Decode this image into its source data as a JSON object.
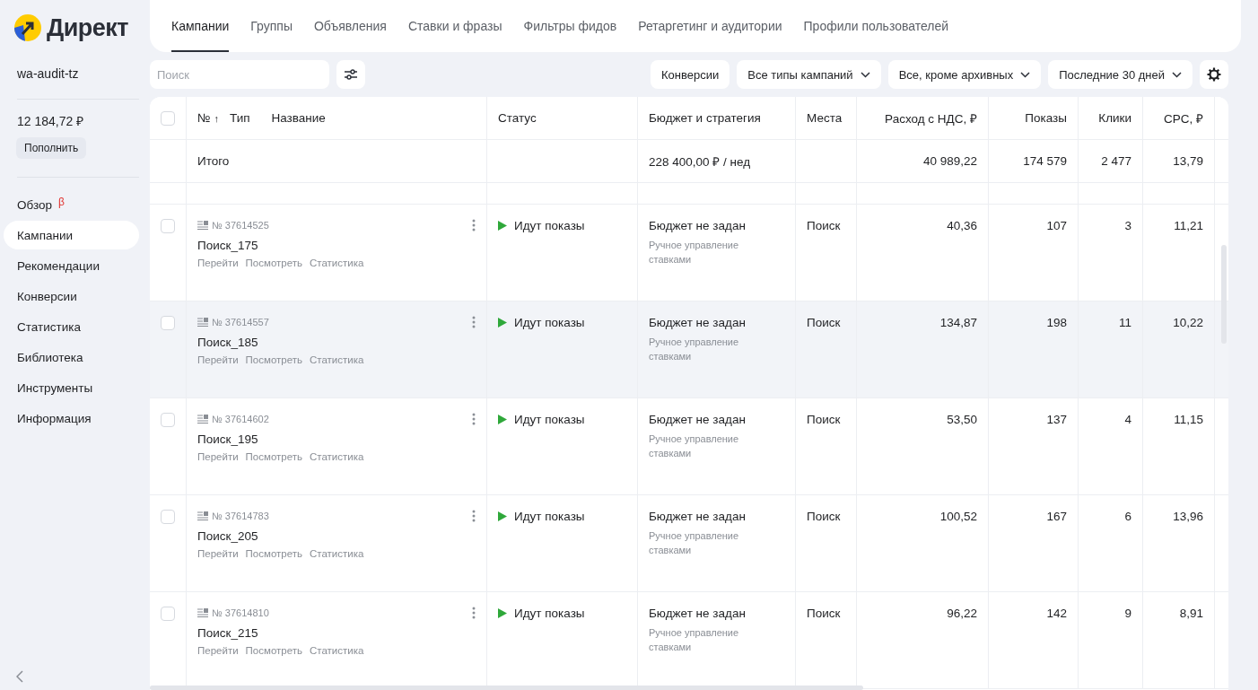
{
  "logo": {
    "text": "Директ"
  },
  "account": {
    "login": "wa-audit-tz",
    "balance": "12 184,72 ₽",
    "topup": "Пополнить"
  },
  "sidebar": {
    "items": [
      {
        "label": "Обзор",
        "badge": "β",
        "selected": false
      },
      {
        "label": "Кампании",
        "selected": true
      },
      {
        "label": "Рекомендации",
        "selected": false
      },
      {
        "label": "Конверсии",
        "selected": false
      },
      {
        "label": "Статистика",
        "selected": false
      },
      {
        "label": "Библиотека",
        "selected": false
      },
      {
        "label": "Инструменты",
        "selected": false
      },
      {
        "label": "Информация",
        "selected": false
      }
    ]
  },
  "tabs": [
    {
      "label": "Кампании",
      "selected": true
    },
    {
      "label": "Группы",
      "selected": false
    },
    {
      "label": "Объявления",
      "selected": false
    },
    {
      "label": "Ставки и фразы",
      "selected": false
    },
    {
      "label": "Фильтры фидов",
      "selected": false
    },
    {
      "label": "Ретаргетинг и аудитории",
      "selected": false
    },
    {
      "label": "Профили пользователей",
      "selected": false
    }
  ],
  "toolbar": {
    "search_placeholder": "Поиск",
    "filters": [
      {
        "label": "Конверсии",
        "dropdown": false
      },
      {
        "label": "Все типы кампаний",
        "dropdown": true
      },
      {
        "label": "Все, кроме архивных",
        "dropdown": true
      },
      {
        "label": "Последние 30 дней",
        "dropdown": true
      }
    ]
  },
  "table": {
    "select_all_checked": false,
    "columns": {
      "number": "№",
      "sort": "↑",
      "type": "Тип",
      "name": "Название",
      "status": "Статус",
      "budget": "Бюджет и стратегия",
      "places": "Места",
      "spend": "Расход с НДС, ₽",
      "shows": "Показы",
      "clicks": "Клики",
      "cpc": "CPC, ₽"
    },
    "total": {
      "label": "Итого",
      "budget": "228 400,00 ₽ / нед",
      "spend": "40 989,22",
      "shows": "174 579",
      "clicks": "2 477",
      "cpc": "13,79"
    },
    "rows": [
      {
        "number": "№ 37614525",
        "name": "Поиск_175",
        "links": [
          "Перейти",
          "Посмотреть",
          "Статистика"
        ],
        "status": "Идут показы",
        "budget": "Бюджет не задан",
        "strategy": "Ручное управление ставками",
        "places": "Поиск",
        "spend": "40,36",
        "shows": "107",
        "clicks": "3",
        "cpc": "11,21",
        "checked": false,
        "highlighted": false
      },
      {
        "number": "№ 37614557",
        "name": "Поиск_185",
        "links": [
          "Перейти",
          "Посмотреть",
          "Статистика"
        ],
        "status": "Идут показы",
        "budget": "Бюджет не задан",
        "strategy": "Ручное управление ставками",
        "places": "Поиск",
        "spend": "134,87",
        "shows": "198",
        "clicks": "11",
        "cpc": "10,22",
        "checked": false,
        "highlighted": true
      },
      {
        "number": "№ 37614602",
        "name": "Поиск_195",
        "links": [
          "Перейти",
          "Посмотреть",
          "Статистика"
        ],
        "status": "Идут показы",
        "budget": "Бюджет не задан",
        "strategy": "Ручное управление ставками",
        "places": "Поиск",
        "spend": "53,50",
        "shows": "137",
        "clicks": "4",
        "cpc": "11,15",
        "checked": false,
        "highlighted": false
      },
      {
        "number": "№ 37614783",
        "name": "Поиск_205",
        "links": [
          "Перейти",
          "Посмотреть",
          "Статистика"
        ],
        "status": "Идут показы",
        "budget": "Бюджет не задан",
        "strategy": "Ручное управление ставками",
        "places": "Поиск",
        "spend": "100,52",
        "shows": "167",
        "clicks": "6",
        "cpc": "13,96",
        "checked": false,
        "highlighted": false
      },
      {
        "number": "№ 37614810",
        "name": "Поиск_215",
        "links": [
          "Перейти",
          "Посмотреть",
          "Статистика"
        ],
        "status": "Идут показы",
        "budget": "Бюджет не задан",
        "strategy": "Ручное управление ставками",
        "places": "Поиск",
        "spend": "96,22",
        "shows": "142",
        "clicks": "9",
        "cpc": "8,91",
        "checked": false,
        "highlighted": false
      }
    ]
  }
}
